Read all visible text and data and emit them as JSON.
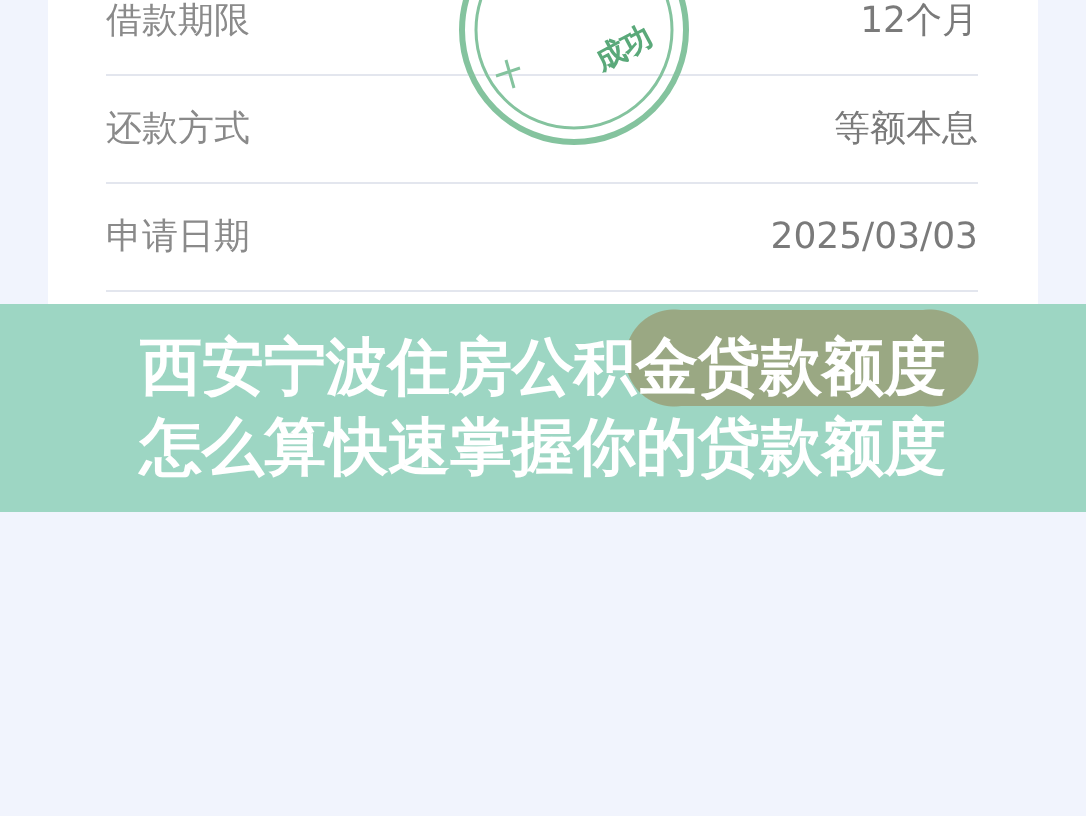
{
  "details": [
    {
      "label": "借款期限",
      "value": "12个月"
    },
    {
      "label": "还款方式",
      "value": "等额本息"
    },
    {
      "label": "申请日期",
      "value": "2025/03/03"
    }
  ],
  "stamp": {
    "text": "成功"
  },
  "banner": {
    "lines": [
      "西安宁波住房公积金贷款额度",
      "怎么算快速掌握你的贷款额度"
    ]
  }
}
